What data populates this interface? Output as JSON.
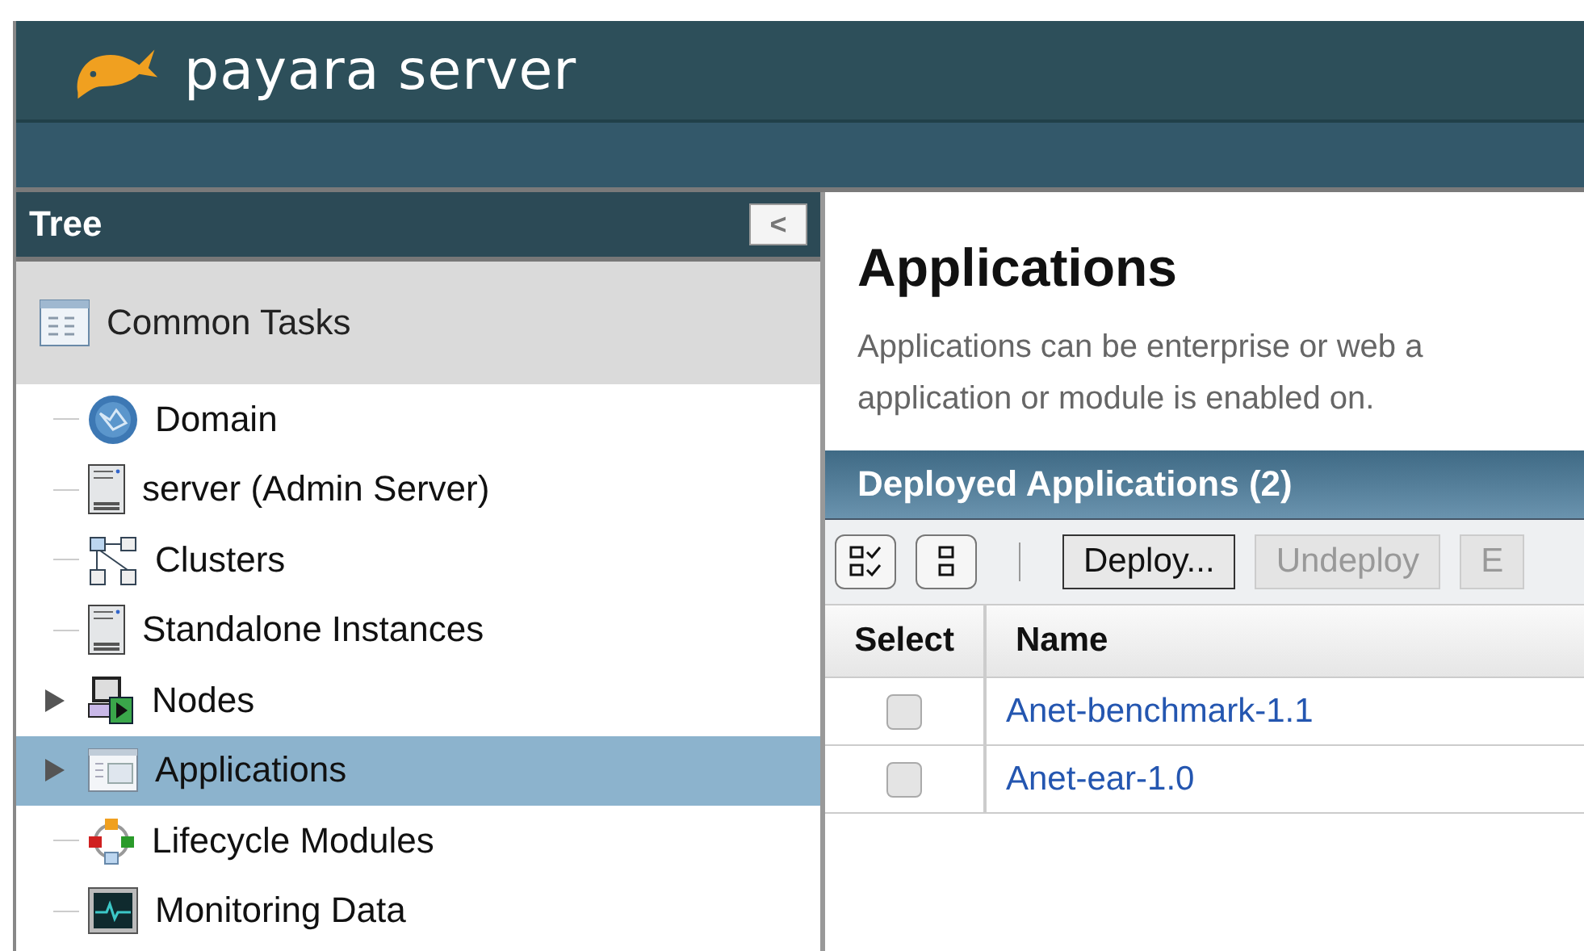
{
  "header": {
    "brand": "payara server"
  },
  "tree": {
    "title": "Tree",
    "collapse_button": "<",
    "common_tasks": "Common Tasks",
    "items": [
      {
        "label": "Domain",
        "kind": "globe",
        "collapsed": false,
        "selected": false
      },
      {
        "label": "server (Admin Server)",
        "kind": "server",
        "collapsed": false,
        "selected": false
      },
      {
        "label": "Clusters",
        "kind": "cluster",
        "collapsed": false,
        "selected": false
      },
      {
        "label": "Standalone Instances",
        "kind": "server",
        "collapsed": false,
        "selected": false
      },
      {
        "label": "Nodes",
        "kind": "nodes",
        "collapsed": true,
        "selected": false
      },
      {
        "label": "Applications",
        "kind": "app",
        "collapsed": true,
        "selected": true
      },
      {
        "label": "Lifecycle Modules",
        "kind": "lifecycle",
        "collapsed": false,
        "selected": false
      },
      {
        "label": "Monitoring Data",
        "kind": "monitor",
        "collapsed": false,
        "selected": false
      }
    ]
  },
  "page": {
    "title": "Applications",
    "description_lines": [
      "Applications can be enterprise or web a",
      "application or module is enabled on."
    ]
  },
  "table": {
    "title": "Deployed Applications (2)",
    "toolbar": [
      {
        "kind": "select-all"
      },
      {
        "kind": "deselect-all"
      },
      {
        "kind": "separator"
      },
      {
        "kind": "button",
        "label": "Deploy...",
        "disabled": false
      },
      {
        "kind": "button",
        "label": "Undeploy",
        "disabled": true
      },
      {
        "kind": "button",
        "label": "E",
        "disabled": true
      }
    ],
    "columns": [
      "Select",
      "Name"
    ],
    "rows": [
      {
        "checked": false,
        "name": "Anet-benchmark-1.1"
      },
      {
        "checked": false,
        "name": "Anet-ear-1.0"
      }
    ]
  }
}
